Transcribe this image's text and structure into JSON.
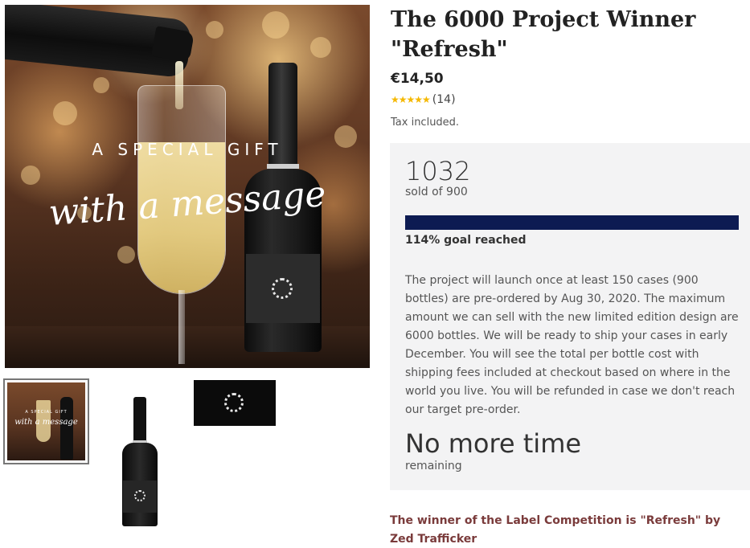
{
  "gallery": {
    "main_image": {
      "overlay_line1": "A SPECIAL GIFT",
      "overlay_line2": "with a message"
    },
    "thumbnails": [
      {
        "name": "gift-message-thumbnail",
        "selected": true
      },
      {
        "name": "bottle-thumbnail",
        "selected": false
      },
      {
        "name": "label-thumbnail",
        "selected": false
      }
    ]
  },
  "product": {
    "title": "The 6000 Project Winner \"Refresh\"",
    "price": "€14,50",
    "rating": {
      "stars": 5,
      "count_text": "(14)"
    },
    "tax_note": "Tax included."
  },
  "project": {
    "sold_count": "1032",
    "sold_of": "sold of 900",
    "progress_fraction": 1.0,
    "goal_text": "114% goal reached",
    "description": "The project will launch once at least 150 cases (900 bottles) are pre-ordered by Aug 30, 2020. The maximum amount we can sell with the new limited edition design are 6000 bottles. We will be ready to ship your cases in early December. You will see the total per bottle cost with shipping fees included at checkout based on where in the world you live. You will be refunded in case we don't reach our target pre-order.",
    "time_left": "No more time",
    "time_left_label": "remaining"
  },
  "winner_note": "The winner of the Label Competition is \"Refresh\" by Zed Trafficker",
  "colors": {
    "progress_fill": "#0d1b52",
    "star": "#f5b800",
    "winner_text": "#7a3b3b",
    "panel_bg": "#f3f3f4"
  }
}
